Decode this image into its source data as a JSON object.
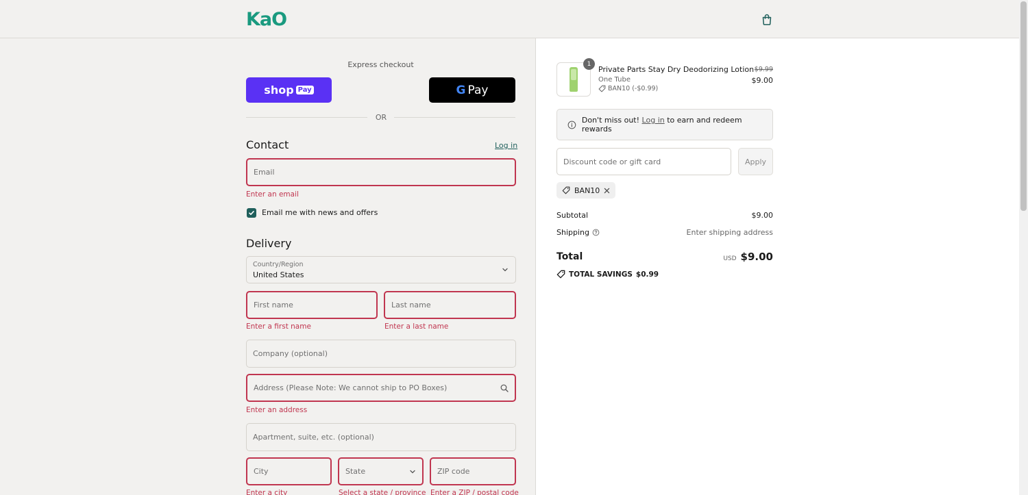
{
  "colors": {
    "brand": "#1a9a7f",
    "shoppay": "#5a31f4",
    "gpay": "#000000",
    "error": "#c0354f",
    "checkbox": "#1f5f5b"
  },
  "header": {
    "logo": "KaO",
    "cart_icon": "shopping-bag-icon"
  },
  "express": {
    "label": "Express checkout",
    "shoppay_label": "shop",
    "shoppay_badge": "Pay",
    "gpay_g": "G",
    "gpay_label": "Pay",
    "or": "OR"
  },
  "contact": {
    "title": "Contact",
    "login": "Log in",
    "email_placeholder": "Email",
    "email_error": "Enter an email",
    "newsletter_label": "Email me with news and offers",
    "newsletter_checked": true
  },
  "delivery": {
    "title": "Delivery",
    "country_label": "Country/Region",
    "country_value": "United States",
    "first_name": "First name",
    "first_name_error": "Enter a first name",
    "last_name": "Last name",
    "last_name_error": "Enter a last name",
    "company": "Company (optional)",
    "address": "Address (Please Note: We cannot ship to PO Boxes)",
    "address_error": "Enter an address",
    "apartment": "Apartment, suite, etc. (optional)",
    "city": "City",
    "city_error": "Enter a city",
    "state": "State",
    "state_error": "Select a state / province",
    "zip": "ZIP code",
    "zip_error": "Enter a ZIP / postal code"
  },
  "summary": {
    "product": {
      "quantity": "1",
      "name": "Private Parts Stay Dry Deodorizing Lotion",
      "variant": "One Tube",
      "discount": "BAN10 (-$0.99)",
      "original_price": "$9.99",
      "price": "$9.00"
    },
    "rewards": {
      "prefix": "Don't miss out!",
      "link": "Log in",
      "suffix": "to earn and redeem rewards"
    },
    "discount_placeholder": "Discount code or gift card",
    "apply": "Apply",
    "applied_code": "BAN10",
    "subtotal_label": "Subtotal",
    "subtotal_value": "$9.00",
    "shipping_label": "Shipping",
    "shipping_value": "Enter shipping address",
    "total_label": "Total",
    "total_currency": "USD",
    "total_value": "$9.00",
    "savings_label": "TOTAL SAVINGS",
    "savings_value": "$0.99"
  }
}
